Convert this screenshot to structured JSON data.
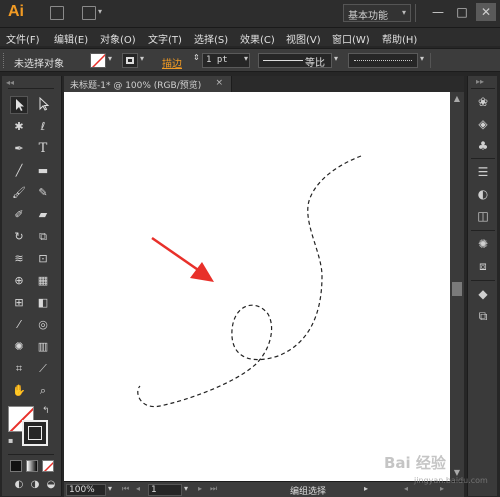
{
  "app": {
    "logo": "Ai",
    "workspace": "基本功能",
    "minimize": "—",
    "maximize": "□",
    "close": "✕"
  },
  "menu": [
    "文件(F)",
    "编辑(E)",
    "对象(O)",
    "文字(T)",
    "选择(S)",
    "效果(C)",
    "视图(V)",
    "窗口(W)",
    "帮助(H)"
  ],
  "control": {
    "selection_label": "未选择对象",
    "stroke_label": "描边",
    "stroke_weight": "1 pt",
    "stroke_style": "等比"
  },
  "document": {
    "tab_title": "未标题-1* @ 100% (RGB/预览)",
    "tab_close": "×"
  },
  "status": {
    "zoom": "100%",
    "artboard_number": "1",
    "tool_status": "编组选择"
  },
  "watermark": {
    "brand": "Bai 经验",
    "url": "jingyan.baidu.com"
  },
  "colors": {
    "accent": "#f29b24",
    "arrow": "#e8302a",
    "stroke_label": "#f29b24"
  },
  "tools": [
    "selection-tool",
    "direct-selection-tool",
    "magic-wand-tool",
    "lasso-tool",
    "pen-tool",
    "type-tool",
    "line-tool",
    "rectangle-tool",
    "paintbrush-tool",
    "pencil-tool",
    "blob-brush-tool",
    "eraser-tool",
    "rotate-tool",
    "scale-tool",
    "width-tool",
    "free-transform-tool",
    "shape-builder-tool",
    "perspective-grid-tool",
    "mesh-tool",
    "gradient-tool",
    "eyedropper-tool",
    "blend-tool",
    "symbol-sprayer-tool",
    "column-graph-tool",
    "artboard-tool",
    "slice-tool",
    "hand-tool",
    "zoom-tool"
  ],
  "dock": [
    "color-guide-panel",
    "color-panel",
    "swatches-panel",
    "brushes-panel",
    "symbols-panel",
    "stroke-panel",
    "gradient-panel",
    "transparency-panel",
    "appearance-panel",
    "graphic-styles-panel",
    "layers-panel",
    "artboards-panel"
  ]
}
